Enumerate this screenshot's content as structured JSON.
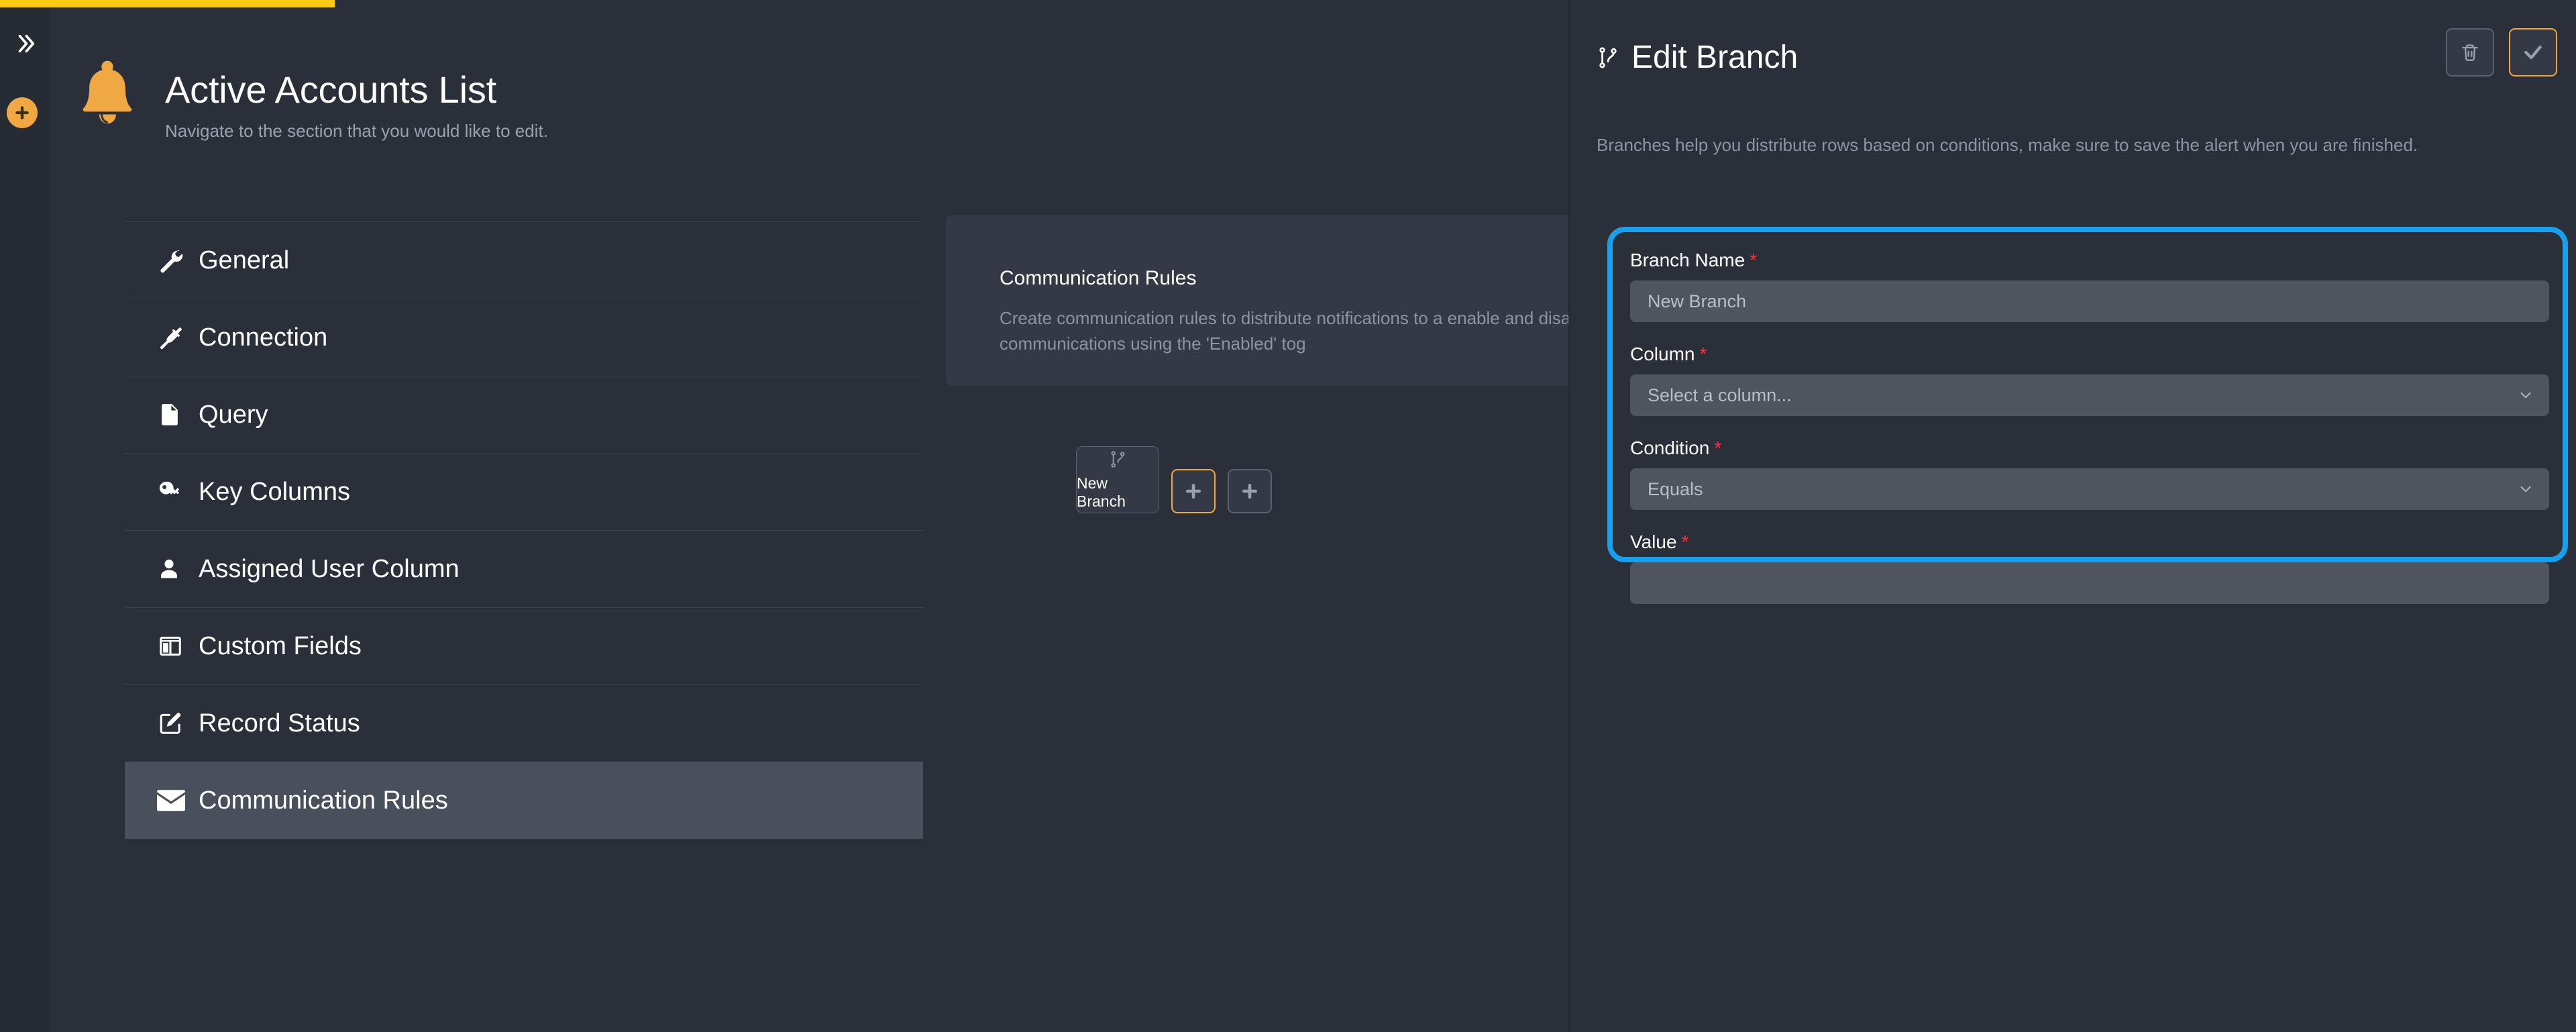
{
  "theme": {
    "bg": "#2b2f3a",
    "panel": "#343945",
    "accent": "#f0a844",
    "progress": "#fbcb16",
    "highlight": "#18a0ed",
    "required": "#f0353d",
    "muted": "#8d94a1"
  },
  "progress": {
    "percent": 13
  },
  "rail": {
    "expand_icon": "chevron-double-right-icon",
    "add_icon": "plus-circle-icon"
  },
  "header": {
    "icon": "bell-icon",
    "title": "Active Accounts List",
    "subtitle": "Navigate to the section that you would like to edit."
  },
  "nav": {
    "items": [
      {
        "label": "General",
        "icon": "wrench-icon",
        "active": false
      },
      {
        "label": "Connection",
        "icon": "plug-icon",
        "active": false
      },
      {
        "label": "Query",
        "icon": "file-icon",
        "active": false
      },
      {
        "label": "Key Columns",
        "icon": "key-icon",
        "active": false
      },
      {
        "label": "Assigned User Column",
        "icon": "user-icon",
        "active": false
      },
      {
        "label": "Custom Fields",
        "icon": "columns-icon",
        "active": false
      },
      {
        "label": "Record Status",
        "icon": "edit-square-icon",
        "active": false
      },
      {
        "label": "Communication Rules",
        "icon": "envelope-icon",
        "active": true
      }
    ]
  },
  "main_card": {
    "title": "Communication Rules",
    "description": "Create communication rules to distribute notifications to a  enable and disable communications using the 'Enabled' tog"
  },
  "branches": {
    "card": {
      "label": "New Branch",
      "icon": "git-branch-icon"
    },
    "add_branch_button": {
      "icon": "plus-icon",
      "accent": true
    },
    "add_rule_button": {
      "icon": "plus-icon",
      "accent": false
    }
  },
  "edit_panel": {
    "icon": "git-branch-icon",
    "title": "Edit Branch",
    "description": "Branches help you distribute rows based on conditions, make sure to save the alert when you are finished.",
    "delete_button": {
      "icon": "trash-icon"
    },
    "confirm_button": {
      "icon": "check-icon"
    },
    "fields": {
      "branch_name": {
        "label": "Branch Name",
        "required": "*",
        "value": "New Branch",
        "placeholder": "New Branch"
      },
      "column": {
        "label": "Column",
        "required": "*",
        "value": "Select a column...",
        "chevron": "chevron-down-icon"
      },
      "condition": {
        "label": "Condition",
        "required": "*",
        "value": "Equals",
        "chevron": "chevron-down-icon"
      },
      "value": {
        "label": "Value",
        "required": "*",
        "value": "",
        "placeholder": ""
      }
    }
  }
}
